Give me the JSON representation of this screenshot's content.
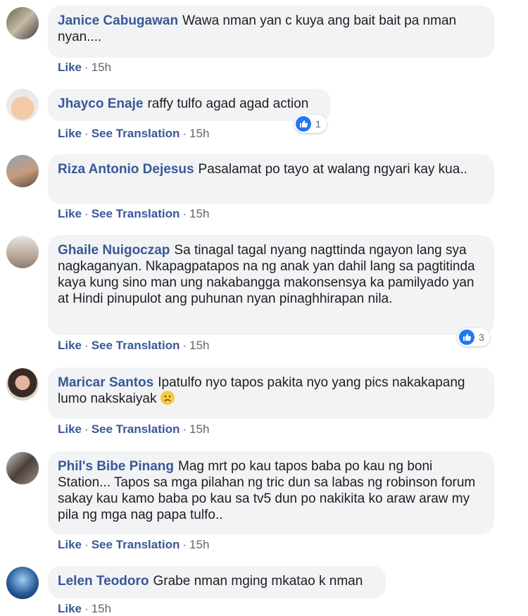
{
  "labels": {
    "like": "Like",
    "see_translation": "See Translation"
  },
  "comments": [
    {
      "author": "Janice Cabugawan",
      "text": "Wawa nman yan c kuya ang bait bait pa nman nyan....",
      "time": "15h"
    },
    {
      "author": "Jhayco Enaje",
      "text": "raffy tulfo agad agad action",
      "time": "15h",
      "reactions": "1"
    },
    {
      "author": "Riza Antonio Dejesus",
      "text": "Pasalamat po tayo at walang ngyari kay kua..",
      "time": "15h"
    },
    {
      "author": "Ghaile Nuigoczap",
      "text": "Sa tinagal tagal nyang nagttinda ngayon lang sya nagkaganyan. Nkapagpatapos na ng anak yan dahil lang sa pagtitinda kaya kung sino man ung nakabangga makonsensya ka pamilyado yan at Hindi pinupulot ang puhunan nyan pinaghhirapan nila.",
      "time": "15h",
      "reactions": "3"
    },
    {
      "author": "Maricar Santos",
      "text": "Ipatulfo nyo tapos pakita nyo yang pics nakakapang lumo nakskaiyak",
      "time": "15h",
      "emoji": "sad-face-emoji"
    },
    {
      "author": "Phil's Bibe Pinang",
      "text": "Mag mrt po kau tapos baba po kau ng boni Station... Tapos sa mga pilahan ng tric dun sa labas ng robinson forum sakay kau kamo baba po kau sa tv5 dun po nakikita ko araw araw my pila ng mga nag papa tulfo..",
      "time": "15h"
    },
    {
      "author": "Lelen Teodoro",
      "text": "Grabe nman mging mkatao k nman",
      "time": "15h"
    }
  ],
  "colors": {
    "author": "#385898",
    "bubble": "#f2f3f5",
    "like_blue": "#2078f4",
    "meta": "#606770"
  }
}
